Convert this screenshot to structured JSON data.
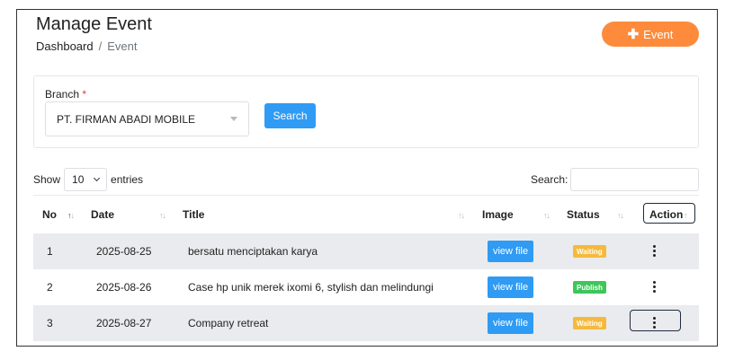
{
  "header": {
    "title": "Manage Event",
    "breadcrumb": {
      "root": "Dashboard",
      "separator": "/",
      "current": "Event"
    },
    "add_button": {
      "icon": "plus-icon",
      "label": "Event"
    }
  },
  "filter": {
    "branch_label": "Branch",
    "required_mark": "*",
    "branch_value": "PT. FIRMAN ABADI MOBILE",
    "search_button": "Search"
  },
  "table_controls": {
    "show_label": "Show",
    "entries_value": "10",
    "entries_label": "entries",
    "search_label": "Search:",
    "search_value": ""
  },
  "table": {
    "columns": [
      "No",
      "Date",
      "Title",
      "Image",
      "Status",
      "Action"
    ],
    "sort_glyph": "↑↓",
    "rows": [
      {
        "no": "1",
        "date": "2025-08-25",
        "title": "bersatu menciptakan karya",
        "image": "view file",
        "status": "Waiting"
      },
      {
        "no": "2",
        "date": "2025-08-26",
        "title": "Case hp unik merek ixomi 6, stylish dan melindungi",
        "image": "view file",
        "status": "Publish"
      },
      {
        "no": "3",
        "date": "2025-08-27",
        "title": "Company retreat",
        "image": "view file",
        "status": "Waiting"
      }
    ]
  },
  "colors": {
    "accent_orange": "#fd8b3b",
    "primary_blue": "#2f9bf4",
    "waiting": "#f6b93b",
    "publish": "#3ec65b",
    "row_shade": "#e9ebee"
  }
}
